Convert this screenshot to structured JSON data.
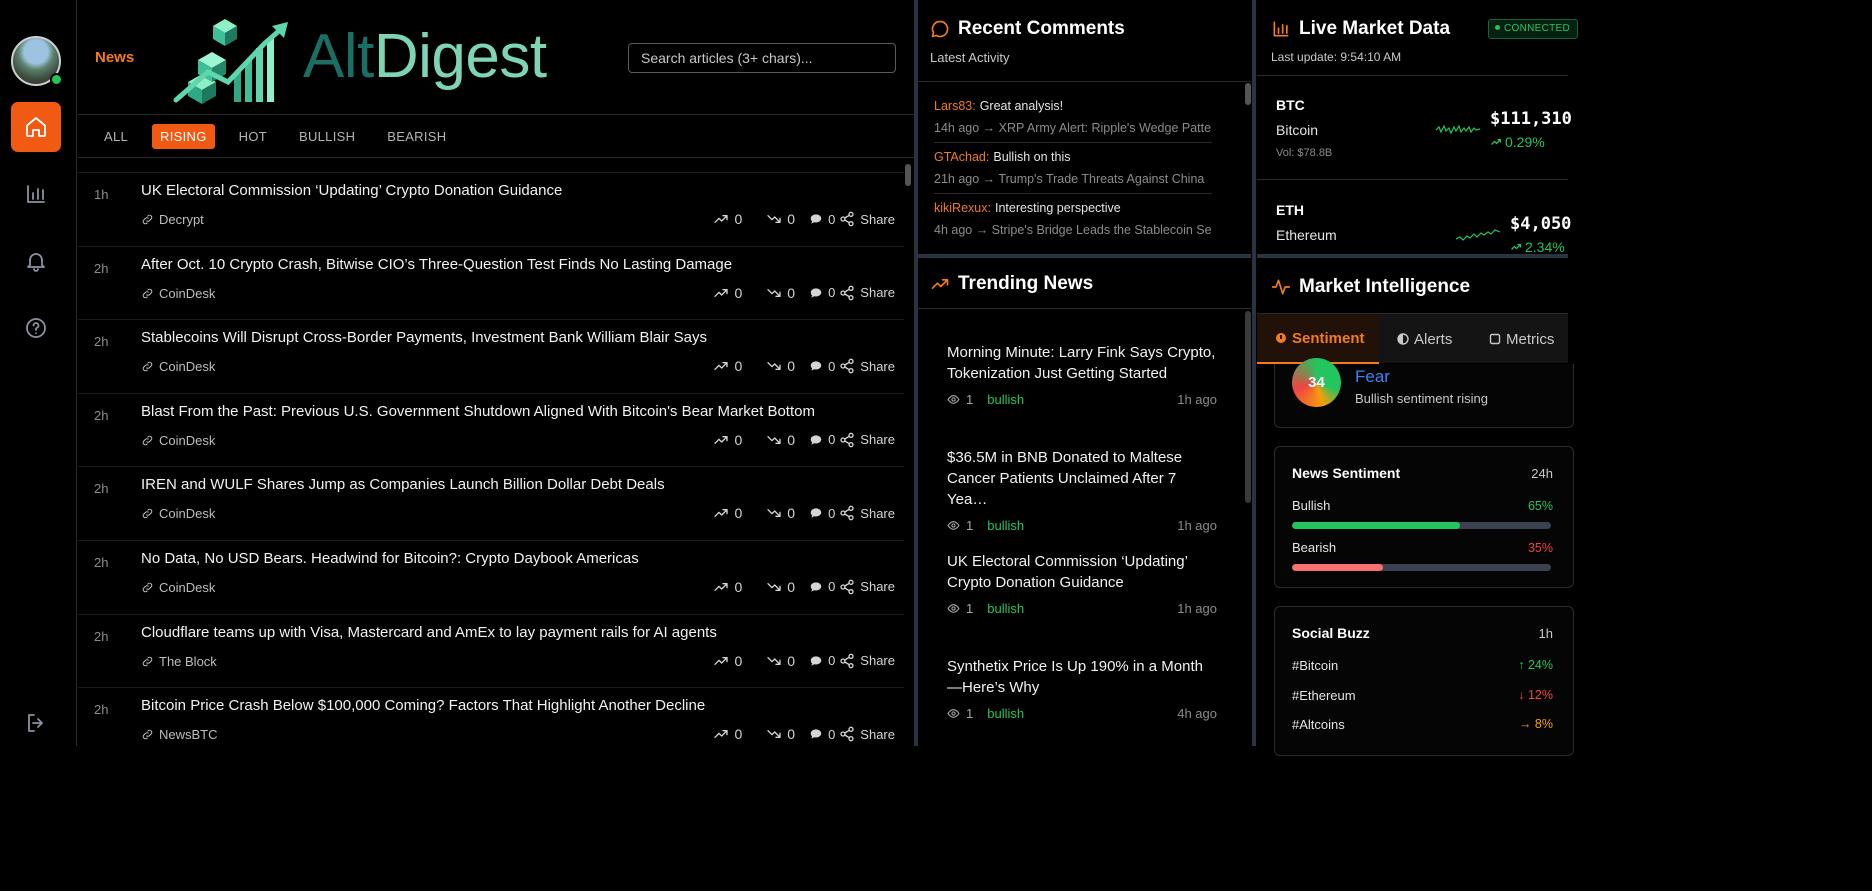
{
  "header": {
    "section_label": "News",
    "logo_part1": "Alt",
    "logo_part2": "Digest",
    "search_placeholder": "Search articles (3+ chars)..."
  },
  "filters": [
    "ALL",
    "RISING",
    "HOT",
    "BULLISH",
    "BEARISH"
  ],
  "active_filter": "RISING",
  "articles": [
    {
      "age": "1h",
      "title": "UK Electoral Commission ‘Updating’ Crypto Donation Guidance",
      "source": "Decrypt",
      "up": "0",
      "down": "0",
      "comments": "0",
      "share": "Share"
    },
    {
      "age": "2h",
      "title": "After Oct. 10 Crypto Crash, Bitwise CIO’s Three-Question Test Finds No Lasting Damage",
      "source": "CoinDesk",
      "up": "0",
      "down": "0",
      "comments": "0",
      "share": "Share"
    },
    {
      "age": "2h",
      "title": "Stablecoins Will Disrupt Cross-Border Payments, Investment Bank William Blair Says",
      "source": "CoinDesk",
      "up": "0",
      "down": "0",
      "comments": "0",
      "share": "Share"
    },
    {
      "age": "2h",
      "title": "Blast From the Past: Previous U.S. Government Shutdown Aligned With Bitcoin's Bear Market Bottom",
      "source": "CoinDesk",
      "up": "0",
      "down": "0",
      "comments": "0",
      "share": "Share"
    },
    {
      "age": "2h",
      "title": "IREN and WULF Shares Jump as Companies Launch Billion Dollar Debt Deals",
      "source": "CoinDesk",
      "up": "0",
      "down": "0",
      "comments": "0",
      "share": "Share"
    },
    {
      "age": "2h",
      "title": "No Data, No USD Bears. Headwind for Bitcoin?: Crypto Daybook Americas",
      "source": "CoinDesk",
      "up": "0",
      "down": "0",
      "comments": "0",
      "share": "Share"
    },
    {
      "age": "2h",
      "title": "Cloudflare teams up with Visa, Mastercard and AmEx to lay payment rails for AI agents",
      "source": "The Block",
      "up": "0",
      "down": "0",
      "comments": "0",
      "share": "Share"
    },
    {
      "age": "2h",
      "title": "Bitcoin Price Crash Below $100,000 Coming? Factors That Highlight Another Decline",
      "source": "NewsBTC",
      "up": "0",
      "down": "0",
      "comments": "0",
      "share": "Share"
    }
  ],
  "comments_panel": {
    "title": "Recent Comments",
    "subtitle": "Latest Activity",
    "items": [
      {
        "user": "Lars83:",
        "text": "Great analysis!",
        "meta": "14h ago → XRP Army Alert: Ripple's Wedge Patte"
      },
      {
        "user": "GTAchad:",
        "text": "Bullish on this",
        "meta": "21h ago → Trump's Trade Threats Against China"
      },
      {
        "user": "kikiRexux:",
        "text": "Interesting perspective",
        "meta": "4h ago → Stripe's Bridge Leads the Stablecoin Se"
      }
    ]
  },
  "trending": {
    "title": "Trending News",
    "items": [
      {
        "title": "Morning Minute: Larry Fink Says Crypto, Tokenization Just Getting Started",
        "views": "1",
        "tag": "bullish",
        "ago": "1h ago"
      },
      {
        "title": "$36.5M in BNB Donated to Maltese Cancer Patients Unclaimed After 7 Yea…",
        "views": "1",
        "tag": "bullish",
        "ago": "1h ago"
      },
      {
        "title": "UK Electoral Commission ‘Updating’ Crypto Donation Guidance",
        "views": "1",
        "tag": "bullish",
        "ago": "1h ago"
      },
      {
        "title": "Synthetix Price Is Up 190% in a Month—Here’s Why",
        "views": "1",
        "tag": "bullish",
        "ago": "4h ago"
      }
    ]
  },
  "market": {
    "title": "Live Market Data",
    "status": "CONNECTED",
    "last_update": "Last update: 9:54:10 AM",
    "coins": [
      {
        "symbol": "BTC",
        "name": "Bitcoin",
        "volume": "Vol: $78.8B",
        "price": "$111,310",
        "change": "0.29%"
      },
      {
        "symbol": "ETH",
        "name": "Ethereum",
        "volume": "",
        "price": "$4,050",
        "change": "2.34%"
      }
    ]
  },
  "intel": {
    "title": "Market Intelligence",
    "tabs": [
      "Sentiment",
      "Alerts",
      "Metrics"
    ],
    "active_tab": "Sentiment",
    "score": "34",
    "score_label": "Fear",
    "score_note": "Bullish sentiment rising",
    "news_sentiment": {
      "title": "News Sentiment",
      "period": "24h",
      "bullish_label": "Bullish",
      "bullish_value": "65%",
      "bullish_fraction": 0.65,
      "bearish_label": "Bearish",
      "bearish_value": "35%",
      "bearish_fraction": 0.35
    },
    "social_buzz": {
      "title": "Social Buzz",
      "period": "1h",
      "items": [
        {
          "tag": "#Bitcoin",
          "change": "↑ 24%",
          "trend": "up"
        },
        {
          "tag": "#Ethereum",
          "change": "↓ 12%",
          "trend": "down"
        },
        {
          "tag": "#Altcoins",
          "change": "→ 8%",
          "trend": "flat"
        }
      ]
    }
  },
  "colors": {
    "accent": "#f05a13",
    "positive": "#22c55e",
    "negative": "#ef4444",
    "neutral": "#f59e0b",
    "link": "#3b82f6"
  }
}
